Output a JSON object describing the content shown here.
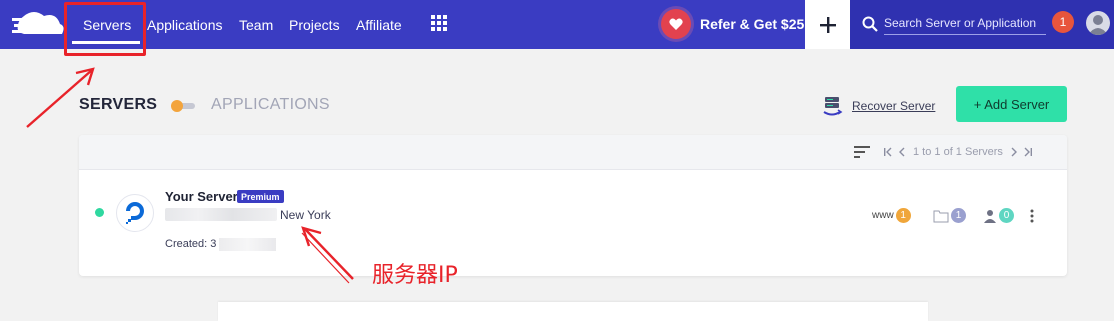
{
  "nav": {
    "items": [
      "Servers",
      "Applications",
      "Team",
      "Projects",
      "Affiliate"
    ],
    "active": "Servers",
    "refer_label": "Refer & Get $25",
    "search_placeholder": "Search Server or Application",
    "notification_count": "1",
    "icons": [
      "cloud-logo-icon",
      "grid-apps-icon",
      "heart-icon",
      "plus-icon",
      "search-icon",
      "user-avatar-icon"
    ]
  },
  "header": {
    "servers_tab": "SERVERS",
    "applications_tab": "APPLICATIONS",
    "recover_label": "Recover Server",
    "add_label": "+ Add Server"
  },
  "list": {
    "pagination": "1 to 1 of 1 Servers",
    "server": {
      "name": "Your Server",
      "badge": "Premium",
      "location": "New York",
      "created_label": "Created: 3",
      "status": "running",
      "stats": [
        {
          "label": "www",
          "value": "1",
          "color": "#f0a63a"
        },
        {
          "label": "",
          "value": "1",
          "color": "#9aa0cf"
        },
        {
          "label": "",
          "value": "0",
          "color": "#5fd6c2"
        }
      ]
    }
  },
  "annotation": {
    "label": "服务器IP",
    "color": "#e8232a"
  },
  "colors": {
    "topbar": "#3a3cc2",
    "accent_green": "#2fe0a8",
    "badge_red": "#e8553c"
  }
}
